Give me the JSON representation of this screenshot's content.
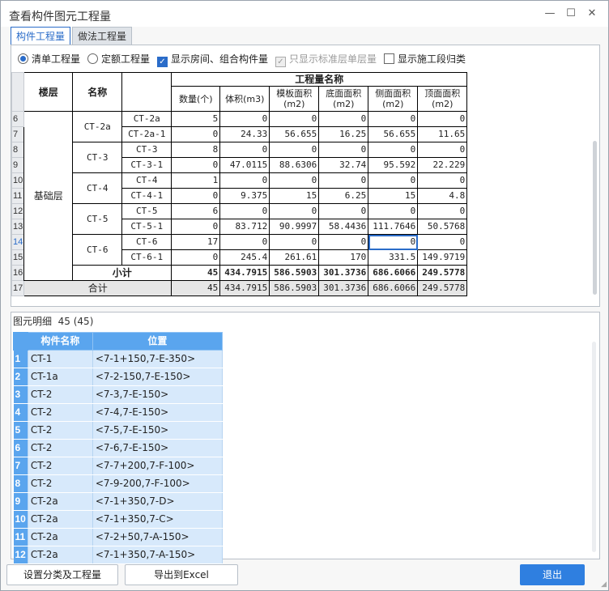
{
  "window": {
    "title": "查看构件图元工程量",
    "minimize": "—",
    "maximize": "☐",
    "close": "✕"
  },
  "tabs": [
    "构件工程量",
    "做法工程量"
  ],
  "options": {
    "radio_qingdan": "清单工程量",
    "radio_dinge": "定额工程量",
    "cb_show_rooms": "显示房间、组合构件量",
    "cb_std_floor": "只显示标准层单层量",
    "cb_show_segments": "显示施工段归类"
  },
  "table": {
    "header": {
      "floor": "楼层",
      "name": "名称",
      "group": "工程量名称",
      "cols": [
        "数量(个)",
        "体积(m3)",
        "模板面积(m2)",
        "底面面积(m2)",
        "侧面面积(m2)",
        "顶面面积(m2)"
      ]
    },
    "floor_name": "基础层",
    "groups": [
      {
        "name": "CT-2a",
        "rows": [
          {
            "row": "6",
            "sub": "CT-2a",
            "v": [
              "5",
              "0",
              "0",
              "0",
              "0",
              "0"
            ]
          },
          {
            "row": "7",
            "sub": "CT-2a-1",
            "v": [
              "0",
              "24.33",
              "56.655",
              "16.25",
              "56.655",
              "11.65"
            ]
          }
        ]
      },
      {
        "name": "CT-3",
        "rows": [
          {
            "row": "8",
            "sub": "CT-3",
            "v": [
              "8",
              "0",
              "0",
              "0",
              "0",
              "0"
            ]
          },
          {
            "row": "9",
            "sub": "CT-3-1",
            "v": [
              "0",
              "47.0115",
              "88.6306",
              "32.74",
              "95.592",
              "22.229"
            ]
          }
        ]
      },
      {
        "name": "CT-4",
        "rows": [
          {
            "row": "10",
            "sub": "CT-4",
            "v": [
              "1",
              "0",
              "0",
              "0",
              "0",
              "0"
            ]
          },
          {
            "row": "11",
            "sub": "CT-4-1",
            "v": [
              "0",
              "9.375",
              "15",
              "6.25",
              "15",
              "4.8"
            ]
          }
        ]
      },
      {
        "name": "CT-5",
        "rows": [
          {
            "row": "12",
            "sub": "CT-5",
            "v": [
              "6",
              "0",
              "0",
              "0",
              "0",
              "0"
            ]
          },
          {
            "row": "13",
            "sub": "CT-5-1",
            "v": [
              "0",
              "83.712",
              "90.9997",
              "58.4436",
              "111.7646",
              "50.5768"
            ]
          }
        ]
      },
      {
        "name": "CT-6",
        "rows": [
          {
            "row": "14",
            "sub": "CT-6",
            "v": [
              "17",
              "0",
              "0",
              "0",
              "0",
              "0"
            ]
          },
          {
            "row": "15",
            "sub": "CT-6-1",
            "v": [
              "0",
              "245.4",
              "261.61",
              "170",
              "331.5",
              "149.9719"
            ]
          }
        ]
      }
    ],
    "subtotal": {
      "row": "16",
      "label": "小计",
      "v": [
        "45",
        "434.7915",
        "586.5903",
        "301.3736",
        "686.6066",
        "249.5778"
      ]
    },
    "total": {
      "row": "17",
      "label": "合计",
      "v": [
        "45",
        "434.7915",
        "586.5903",
        "301.3736",
        "686.6066",
        "249.5778"
      ]
    }
  },
  "detail": {
    "label": "图元明细",
    "count": "45 (45)",
    "headers": [
      "构件名称",
      "位置"
    ],
    "rows": [
      {
        "n": "1",
        "name": "CT-1",
        "pos": "<7-1+150,7-E-350>"
      },
      {
        "n": "2",
        "name": "CT-1a",
        "pos": "<7-2-150,7-E-150>"
      },
      {
        "n": "3",
        "name": "CT-2",
        "pos": "<7-3,7-E-150>"
      },
      {
        "n": "4",
        "name": "CT-2",
        "pos": "<7-4,7-E-150>"
      },
      {
        "n": "5",
        "name": "CT-2",
        "pos": "<7-5,7-E-150>"
      },
      {
        "n": "6",
        "name": "CT-2",
        "pos": "<7-6,7-E-150>"
      },
      {
        "n": "7",
        "name": "CT-2",
        "pos": "<7-7+200,7-F-100>"
      },
      {
        "n": "8",
        "name": "CT-2",
        "pos": "<7-9-200,7-F-100>"
      },
      {
        "n": "9",
        "name": "CT-2a",
        "pos": "<7-1+350,7-D>"
      },
      {
        "n": "10",
        "name": "CT-2a",
        "pos": "<7-1+350,7-C>"
      },
      {
        "n": "11",
        "name": "CT-2a",
        "pos": "<7-2+50,7-A-150>"
      },
      {
        "n": "12",
        "name": "CT-2a",
        "pos": "<7-1+350,7-A-150>"
      }
    ]
  },
  "buttons": {
    "set_category": "设置分类及工程量",
    "export_excel": "导出到Excel",
    "exit": "退出"
  },
  "colors": {
    "accent": "#2f7fe0",
    "header_blue": "#5aa5ee",
    "row_blue": "#d7e9fb"
  }
}
